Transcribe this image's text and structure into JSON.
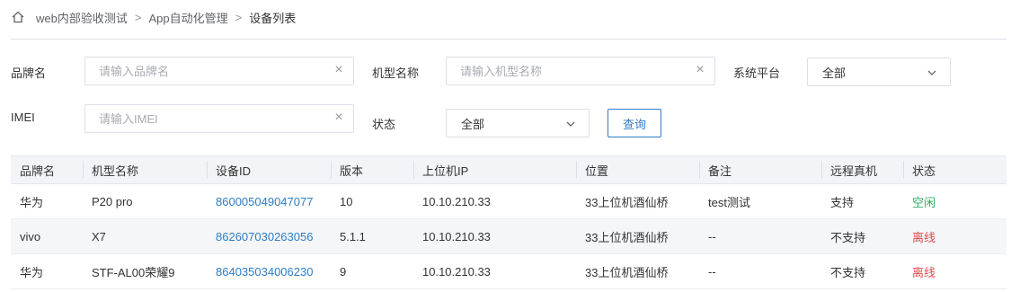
{
  "breadcrumb": {
    "items": [
      "web内部验收测试",
      "App自动化管理",
      "设备列表"
    ]
  },
  "filters": {
    "brand": {
      "label": "品牌名",
      "placeholder": "请输入品牌名"
    },
    "model": {
      "label": "机型名称",
      "placeholder": "请输入机型名称"
    },
    "platform": {
      "label": "系统平台",
      "value": "全部"
    },
    "imei": {
      "label": "IMEI",
      "placeholder": "请输入IMEI"
    },
    "status": {
      "label": "状态",
      "value": "全部"
    },
    "query_button": "查询"
  },
  "table": {
    "columns": [
      "品牌名",
      "机型名称",
      "设备ID",
      "版本",
      "上位机IP",
      "位置",
      "备注",
      "远程真机",
      "状态"
    ],
    "rows": [
      {
        "brand": "华为",
        "model": "P20 pro",
        "device_id": "860005049047077",
        "version": "10",
        "ip": "10.10.210.33",
        "location": "33上位机酒仙桥",
        "remark": "test测试",
        "remote": "支持",
        "status": "空闲",
        "status_color": "#2bae64"
      },
      {
        "brand": "vivo",
        "model": "X7",
        "device_id": "862607030263056",
        "version": "5.1.1",
        "ip": "10.10.210.33",
        "location": "33上位机酒仙桥",
        "remark": "--",
        "remote": "不支持",
        "status": "离线",
        "status_color": "#e04b4b"
      },
      {
        "brand": "华为",
        "model": "STF-AL00荣耀9",
        "device_id": "864035034006230",
        "version": "9",
        "ip": "10.10.210.33",
        "location": "33上位机酒仙桥",
        "remark": "--",
        "remote": "不支持",
        "status": "离线",
        "status_color": "#e04b4b"
      }
    ]
  },
  "colors": {
    "link": "#2d7dc6",
    "idle": "#2bae64",
    "offline": "#e04b4b",
    "header_bg": "#f2f4f7"
  },
  "icons": {
    "home": "home-icon",
    "separator": "chevron-right-icon",
    "clear": "close-icon",
    "dropdown": "chevron-down-icon"
  }
}
